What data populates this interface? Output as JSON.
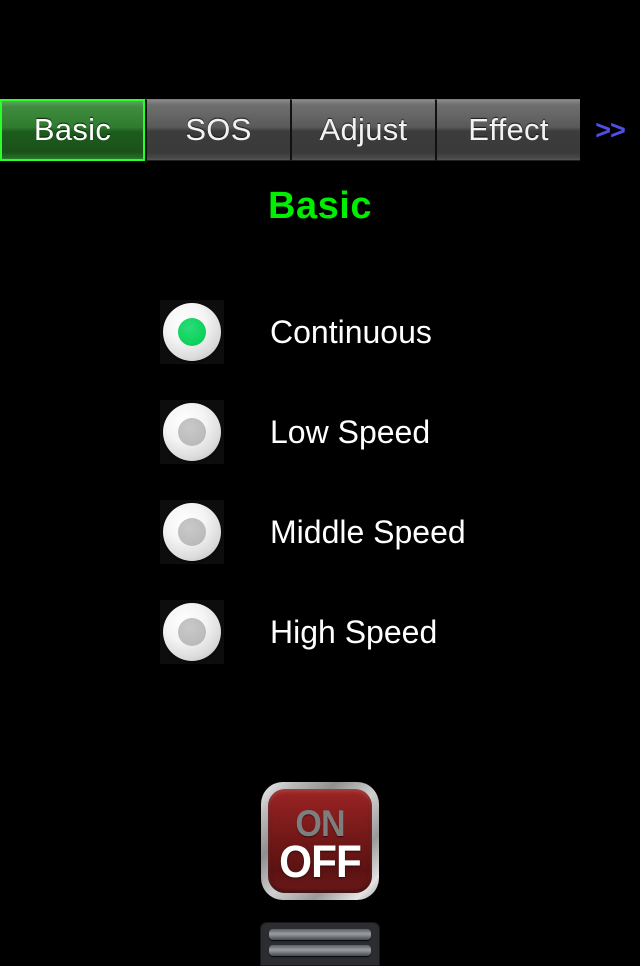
{
  "tabbar": {
    "tabs": [
      {
        "label": "Basic",
        "active": true
      },
      {
        "label": "SOS",
        "active": false
      },
      {
        "label": "Adjust",
        "active": false
      },
      {
        "label": "Effect",
        "active": false
      }
    ],
    "more_label": ">>",
    "active_border_color": "#2bff2b"
  },
  "page": {
    "title": "Basic",
    "title_color": "#00ef00"
  },
  "options": {
    "items": [
      {
        "label": "Continuous",
        "selected": true
      },
      {
        "label": "Low Speed",
        "selected": false
      },
      {
        "label": "Middle Speed",
        "selected": false
      },
      {
        "label": "High Speed",
        "selected": false
      }
    ],
    "selected_dot_color": "#11d45f",
    "unselected_dot_color": "#bdbdbd"
  },
  "power_button": {
    "on_label": "ON",
    "off_label": "OFF",
    "on_color": "#7e7e7e",
    "off_color": "#ffffff",
    "body_color": "#721818"
  },
  "grip": {
    "bars": 2
  }
}
